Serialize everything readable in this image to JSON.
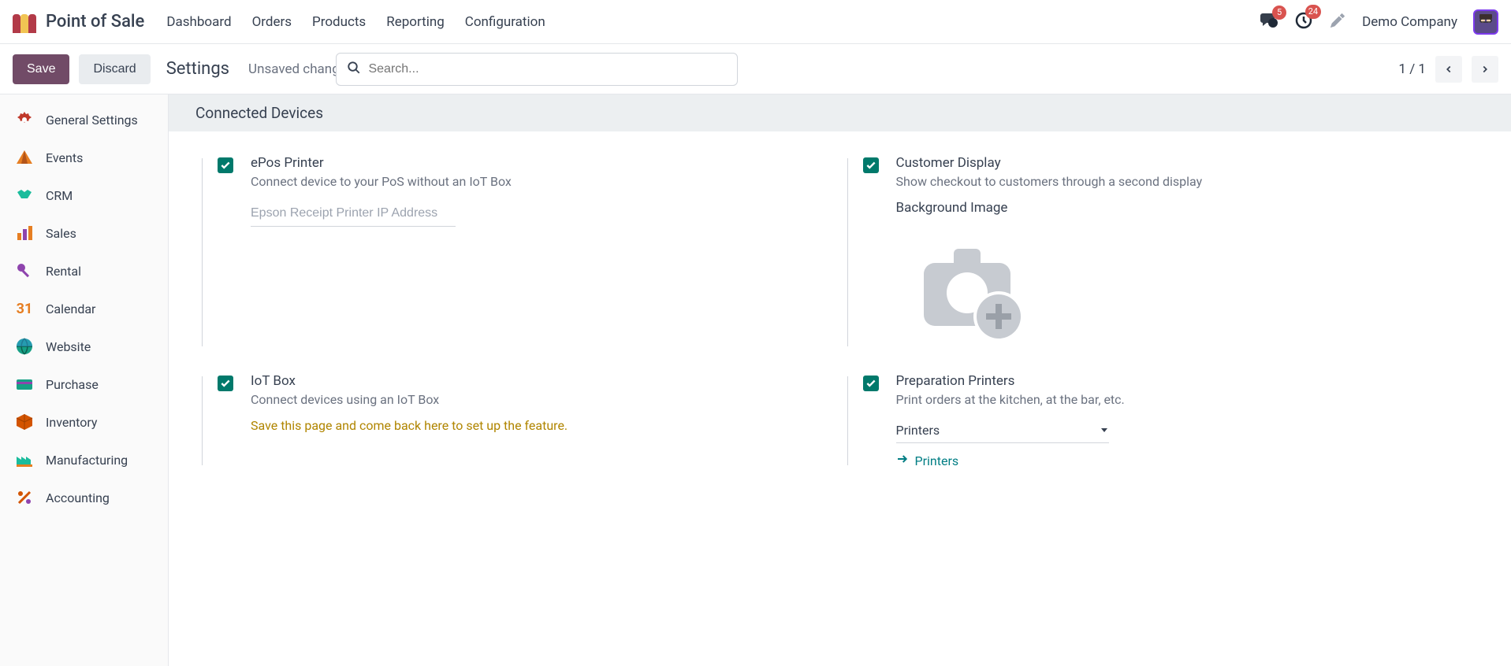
{
  "topbar": {
    "app_name": "Point of Sale",
    "nav": [
      "Dashboard",
      "Orders",
      "Products",
      "Reporting",
      "Configuration"
    ],
    "messages_badge": "5",
    "activities_badge": "24",
    "company": "Demo Company"
  },
  "actionbar": {
    "save": "Save",
    "discard": "Discard",
    "title": "Settings",
    "unsaved": "Unsaved changes",
    "search_placeholder": "Search...",
    "pager": "1 / 1"
  },
  "sidebar": {
    "items": [
      {
        "label": "General Settings",
        "icon": "gear",
        "color": "#c0392b"
      },
      {
        "label": "Events",
        "icon": "tent",
        "color": "#e67e22"
      },
      {
        "label": "CRM",
        "icon": "handshake",
        "color": "#1abc9c"
      },
      {
        "label": "Sales",
        "icon": "chart",
        "color": "#e67e22"
      },
      {
        "label": "Rental",
        "icon": "key",
        "color": "#8e44ad"
      },
      {
        "label": "Calendar",
        "icon": "calendar",
        "color": "#e67e22"
      },
      {
        "label": "Website",
        "icon": "globe",
        "color": "#16a085"
      },
      {
        "label": "Purchase",
        "icon": "card",
        "color": "#16a085"
      },
      {
        "label": "Inventory",
        "icon": "box",
        "color": "#d35400"
      },
      {
        "label": "Manufacturing",
        "icon": "factory",
        "color": "#1abc9c"
      },
      {
        "label": "Accounting",
        "icon": "percent",
        "color": "#d35400"
      }
    ]
  },
  "section": {
    "title": "Connected Devices",
    "epos": {
      "title": "ePos Printer",
      "desc": "Connect device to your PoS without an IoT Box",
      "placeholder": "Epson Receipt Printer IP Address"
    },
    "customer_display": {
      "title": "Customer Display",
      "desc": "Show checkout to customers through a second display",
      "bg_label": "Background Image"
    },
    "iot": {
      "title": "IoT Box",
      "desc": "Connect devices using an IoT Box",
      "warning": "Save this page and come back here to set up the feature."
    },
    "prep": {
      "title": "Preparation Printers",
      "desc": "Print orders at the kitchen, at the bar, etc.",
      "dropdown_label": "Printers",
      "link": "Printers"
    }
  }
}
